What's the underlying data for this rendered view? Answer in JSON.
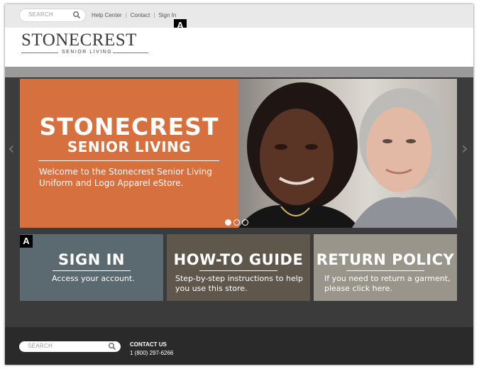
{
  "topbar": {
    "search_placeholder": "SEARCH",
    "links": [
      "Help Center",
      "Contact",
      "Sign In"
    ]
  },
  "markers": [
    "A",
    "A"
  ],
  "logo": {
    "name": "STONECREST",
    "tagline": "SENIOR LIVING"
  },
  "hero": {
    "title_line1": "STONECREST",
    "title_line2": "SENIOR LIVING",
    "welcome": "Welcome to the Stonecrest Senior Living Uniform and Logo Apparel eStore.",
    "active_slide": 1,
    "slide_count": 3
  },
  "tiles": [
    {
      "title": "SIGN IN",
      "desc": "Access your account.",
      "color": "#5a6a70"
    },
    {
      "title": "HOW-TO GUIDE",
      "desc": "Step-by-step instructions to help you use this store.",
      "color": "#5f574c"
    },
    {
      "title": "RETURN POLICY",
      "desc": "If you need to return a garment, please click here.",
      "color": "#9a958b"
    }
  ],
  "footer": {
    "search_placeholder": "SEARCH",
    "contact_label": "CONTACT US",
    "phone": "1 (800) 297-6266"
  },
  "colors": {
    "hero_orange": "#d7703f",
    "frame": "#3b3b3b"
  }
}
